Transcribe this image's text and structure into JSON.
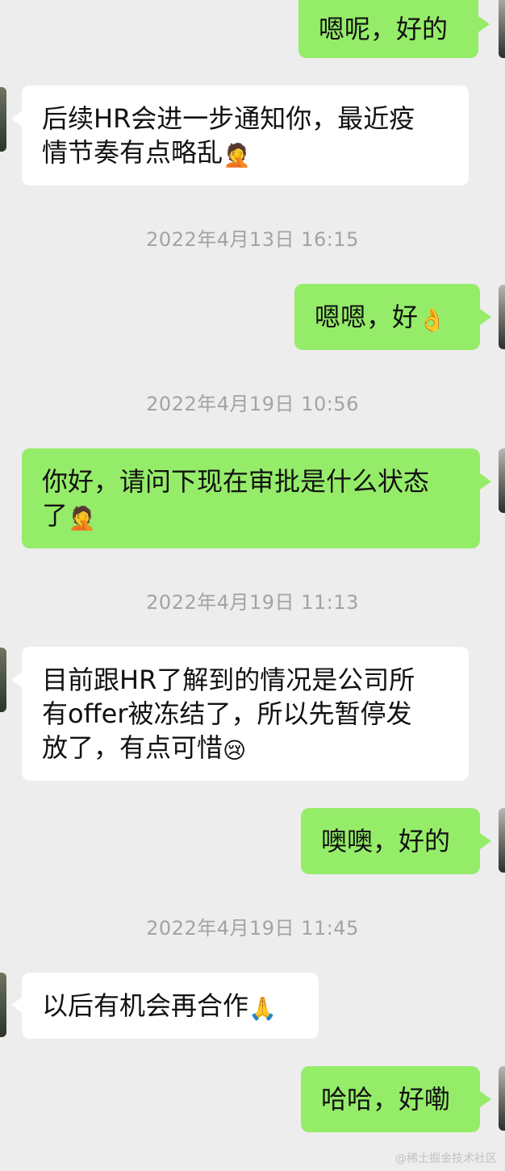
{
  "timestamps": [
    "2022年4月13日 16:15",
    "2022年4月19日 10:56",
    "2022年4月19日 11:13",
    "2022年4月19日 11:45"
  ],
  "messages": [
    {
      "side": "right",
      "lines": [
        "嗯呢，好的"
      ]
    },
    {
      "side": "left",
      "lines": [
        "后续HR会进一步通知你，最近疫",
        "情节奏有点略乱"
      ],
      "emoji": "facepalm-emoji"
    },
    {
      "side": "right",
      "lines": [
        "嗯嗯，好"
      ],
      "emoji": "ok-hand-emoji"
    },
    {
      "side": "right",
      "lines": [
        "你好，请问下现在审批是什么状态",
        "了"
      ],
      "emoji": "facepalm-emoji"
    },
    {
      "side": "left",
      "lines": [
        "目前跟HR了解到的情况是公司所",
        "有offer被冻结了，所以先暂停发",
        "放了，有点可惜"
      ],
      "emoji": "crying-face-emoji"
    },
    {
      "side": "right",
      "lines": [
        "噢噢，好的"
      ]
    },
    {
      "side": "left",
      "lines": [
        "以后有机会再合作"
      ],
      "emoji": "folded-hands-emoji"
    },
    {
      "side": "right",
      "lines": [
        "哈哈，好嘞"
      ]
    }
  ],
  "emoji_glyphs": {
    "facepalm": "🤦",
    "ok_hand": "👌",
    "crying": "😢",
    "folded_hands": "🙏"
  },
  "watermark": "@稀土掘金技术社区",
  "colors": {
    "background": "#ededed",
    "self_bubble": "#95ec69",
    "other_bubble": "#ffffff",
    "timestamp_text": "#a3a3a3"
  }
}
